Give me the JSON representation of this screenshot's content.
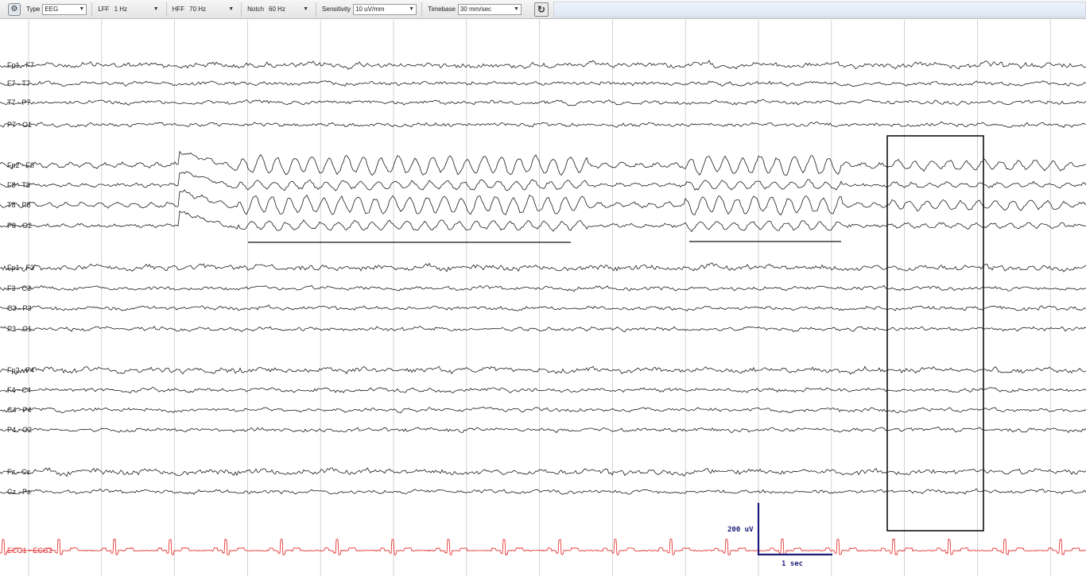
{
  "toolbar": {
    "type_label": "Type",
    "type_value": "EEG",
    "lff_label": "LFF",
    "lff_value": "1 Hz",
    "hff_label": "HFF",
    "hff_value": "70 Hz",
    "notch_label": "Notch",
    "notch_value": "60 Hz",
    "sensitivity_label": "Sensitivity",
    "sensitivity_value": "10 uV/mm",
    "timebase_label": "Timebase",
    "timebase_value": "30 mm/sec",
    "settings_icon": "gear-icon",
    "refresh_icon": "refresh-icon"
  },
  "channels": [
    {
      "label": "Fp1 - F7",
      "group": 1
    },
    {
      "label": "F7 - T7",
      "group": 1
    },
    {
      "label": "T7 - P7",
      "group": 1
    },
    {
      "label": "P7 - O1",
      "group": 1
    },
    {
      "label": "Fp2 - F8",
      "group": 2
    },
    {
      "label": "F8 - T8",
      "group": 2
    },
    {
      "label": "T8 - P8",
      "group": 2
    },
    {
      "label": "P8 - O2",
      "group": 2
    },
    {
      "label": "Fp1 - F3",
      "group": 3
    },
    {
      "label": "F3 - C3",
      "group": 3
    },
    {
      "label": "C3 - P3",
      "group": 3
    },
    {
      "label": "P3 - O1",
      "group": 3
    },
    {
      "label": "Fp2 - F4",
      "group": 4
    },
    {
      "label": "F4 - C4",
      "group": 4
    },
    {
      "label": "C4 - P4",
      "group": 4
    },
    {
      "label": "P4 - O2",
      "group": 4
    },
    {
      "label": "Fz - Cz",
      "group": 5
    },
    {
      "label": "Cz - Pz",
      "group": 5
    },
    {
      "label": "ECG1 - ECG2",
      "group": 6,
      "ecg": true
    }
  ],
  "calibration": {
    "amplitude_label": "200 uV",
    "time_label": "1 sec"
  },
  "colors": {
    "trace": "#1a1a1a",
    "ecg": "#e02020",
    "grid": "#c8c8c8",
    "calibration": "#1c1c7a",
    "annotation": "#111111"
  }
}
